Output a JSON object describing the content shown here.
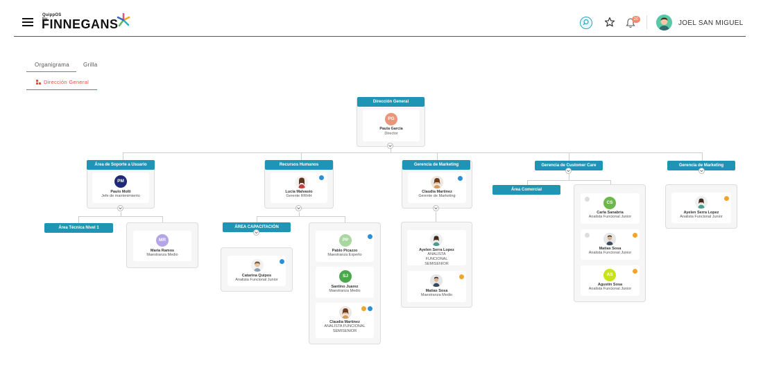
{
  "header": {
    "logo_small": "QuippOS by",
    "logo_big": "FINNEGANS",
    "notification_count": "20",
    "user_name": "JOEL SAN MIGUEL"
  },
  "tabs": {
    "organigrama": "Organigrama",
    "grilla": "Grilla"
  },
  "breadcrumb": {
    "label": "Dirección General"
  },
  "nodes": {
    "direccion": {
      "title": "Dirección General",
      "initials": "PG",
      "name": "Paula Garcia",
      "role": "Director"
    },
    "soporte": {
      "title": "Área de Soporte a Usuario",
      "initials": "PM",
      "name": "Paulo Molti",
      "role": "Jefe de mantenimiento"
    },
    "rrhh": {
      "title": "Recursos Humanos",
      "name": "Lucia Malvasio",
      "role": "Gerente RRHH"
    },
    "marketing1": {
      "title": "Gerencia de Marketing",
      "name": "Claudia Martinez",
      "role": "Gerente de Marketing"
    },
    "customer": {
      "title": "Gerencia de Customer Care"
    },
    "marketing2": {
      "title": "Gerencia de Marketing",
      "name": "Ayelen Serra Lopez",
      "role": "Analista Funcional Junior"
    },
    "tecnica": {
      "title": "Área Técnica Nivel 1"
    },
    "soporte_team": {
      "initials": "MR",
      "name": "Maria Ramos",
      "role": "Maestranza Medio"
    },
    "capacitacion": {
      "title": "ÁREA CAPACITACIÓN",
      "name": "Catarina Quipos",
      "role": "Analista Funcional Junior"
    },
    "rrhh_team": [
      {
        "initials": "PP",
        "name": "Pablo Picazzo",
        "role": "Maestranza Experto"
      },
      {
        "initials": "SJ",
        "name": "Santino Juarez",
        "role": "Maestranza Medio"
      },
      {
        "name": "Claudia Martinez",
        "role": "ANALISTA FUNCIONAL SEMISENIOR"
      }
    ],
    "marketing_team": [
      {
        "name": "Ayelen Serra Lopez",
        "role": "ANALISTA FUNCIONAL SEMISENIOR"
      },
      {
        "name": "Matias Sosa",
        "role": "Maestranza Medio"
      }
    ],
    "comercial": {
      "title": "Área Comercial"
    },
    "customer_team": [
      {
        "initials": "CS",
        "name": "Carla Sanabria",
        "role": "Analista Funcional Junior"
      },
      {
        "name": "Matias Sosa",
        "role": "Analista Funcional Junior"
      },
      {
        "initials": "AS",
        "name": "Agustin Sosa",
        "role": "Analista Funcional Junior"
      }
    ]
  },
  "colors": {
    "node_header": "#1f94b5",
    "accent_red": "#e0523d",
    "avatar_pg": "#e9967a",
    "avatar_pm": "#1e2a78",
    "avatar_mr": "#b3a5e6",
    "avatar_pp": "#a8d8a0",
    "avatar_sj": "#4aa84a",
    "avatar_cs": "#6cb84a",
    "avatar_as": "#c8e21e"
  }
}
